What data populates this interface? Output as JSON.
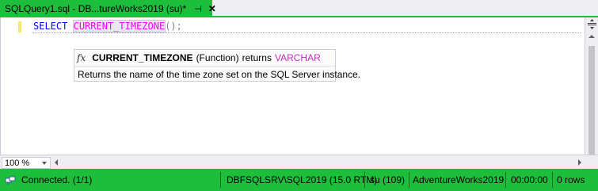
{
  "tab": {
    "title": "SQLQuery1.sql - DB...tureWorks2019 (su)*",
    "pin_icon": "pin-icon",
    "close_icon": "close-icon"
  },
  "editor": {
    "code": {
      "keyword": "SELECT",
      "function": "CURRENT_TIMEZONE",
      "parens": "();"
    }
  },
  "tooltip": {
    "icon": "fx",
    "name": "CURRENT_TIMEZONE",
    "kind": "(Function)",
    "returns_label": "returns",
    "return_type": "VARCHAR",
    "description": "Returns the name of the time zone set on the SQL Server instance."
  },
  "zoom": {
    "value": "100 %"
  },
  "status": {
    "connection": "Connected. (1/1)",
    "server": "DBFSQLSRV\\SQL2019 (15.0 RTM)",
    "user": "su (109)",
    "database": "AdventureWorks2019",
    "elapsed": "00:00:00",
    "rows": "0 rows"
  },
  "colors": {
    "accent": "#1dbe3c",
    "keyword": "#0000ff",
    "function": "#ff00ff",
    "return_type": "#c030c0"
  }
}
